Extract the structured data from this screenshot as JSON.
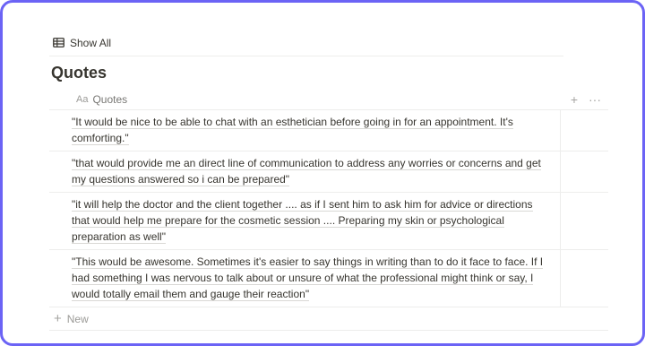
{
  "view": {
    "label": "Show All",
    "icon": "table-icon"
  },
  "title": "Quotes",
  "table": {
    "column": {
      "label": "Quotes",
      "icon_text": "Aa"
    },
    "actions": {
      "add": "+",
      "more": "···"
    },
    "rows": [
      "\"It would be nice to be able to chat with an esthetician before going in for an appointment. It's comforting.\"",
      "\"that would provide me an direct line of communication to address any worries or concerns and get my questions answered so i can be prepared\"",
      "\"it will help the doctor and the client together .... as if I sent him to ask him for advice or directions that would help me prepare for the cosmetic session .... Preparing my skin or psychological preparation as well\"",
      "\"This would be awesome. Sometimes it's easier to say things in writing than to do it face to face. If I had something I was nervous to talk about or unsure of what the professional might think or say, I would totally email them and gauge their reaction\""
    ],
    "new_label": "New"
  }
}
